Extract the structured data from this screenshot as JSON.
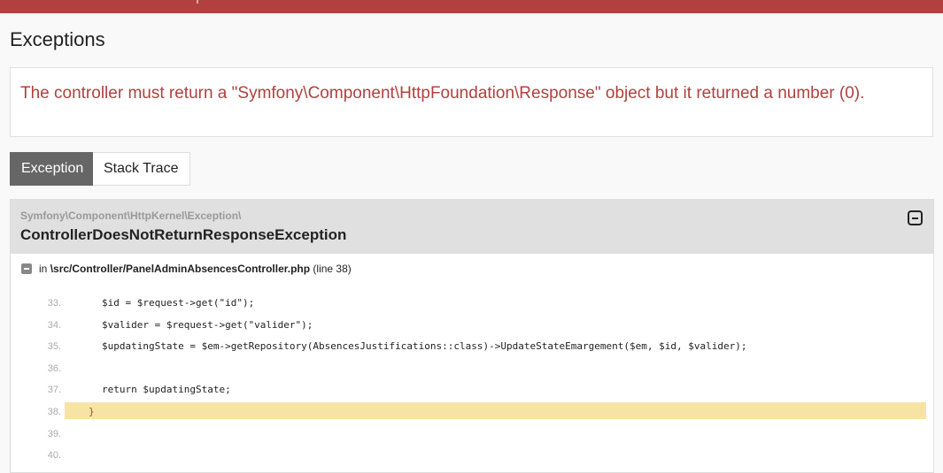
{
  "page": {
    "title": "Exceptions",
    "message": "The controller must return a \"Symfony\\Component\\HttpFoundation\\Response\" object but it returned a number (0)."
  },
  "tabs": [
    {
      "label": "Exception",
      "active": true
    },
    {
      "label": "Stack Trace",
      "active": false
    }
  ],
  "exception": {
    "namespace": "Symfony\\Component\\HttpKernel\\Exception\\",
    "class": "ControllerDoesNotReturnResponseException",
    "location_prefix": "in",
    "file": "\\src/Controller/PanelAdminAbsencesController.php",
    "line_info": "(line 38)",
    "highlight_line": 38,
    "code": [
      {
        "no": "33.",
        "text": "$id = $request->get(\"id\");"
      },
      {
        "no": "34.",
        "text": "$valider = $request->get(\"valider\");"
      },
      {
        "no": "35.",
        "text": "$updatingState = $em->getRepository(AbsencesJustifications::class)->UpdateStateEmargement($em, $id, $valider);"
      },
      {
        "no": "36.",
        "text": ""
      },
      {
        "no": "37.",
        "text": "return $updatingState;"
      },
      {
        "no": "38.",
        "text": "}"
      },
      {
        "no": "39.",
        "text": ""
      },
      {
        "no": "40.",
        "text": ""
      }
    ]
  },
  "colors": {
    "accent": "#b0413e",
    "highlight": "#f7e4a5",
    "tab_active": "#666666"
  },
  "icons": {
    "panel_toggle": "collapse-square-icon",
    "file_toggle": "collapse-minus-icon"
  }
}
